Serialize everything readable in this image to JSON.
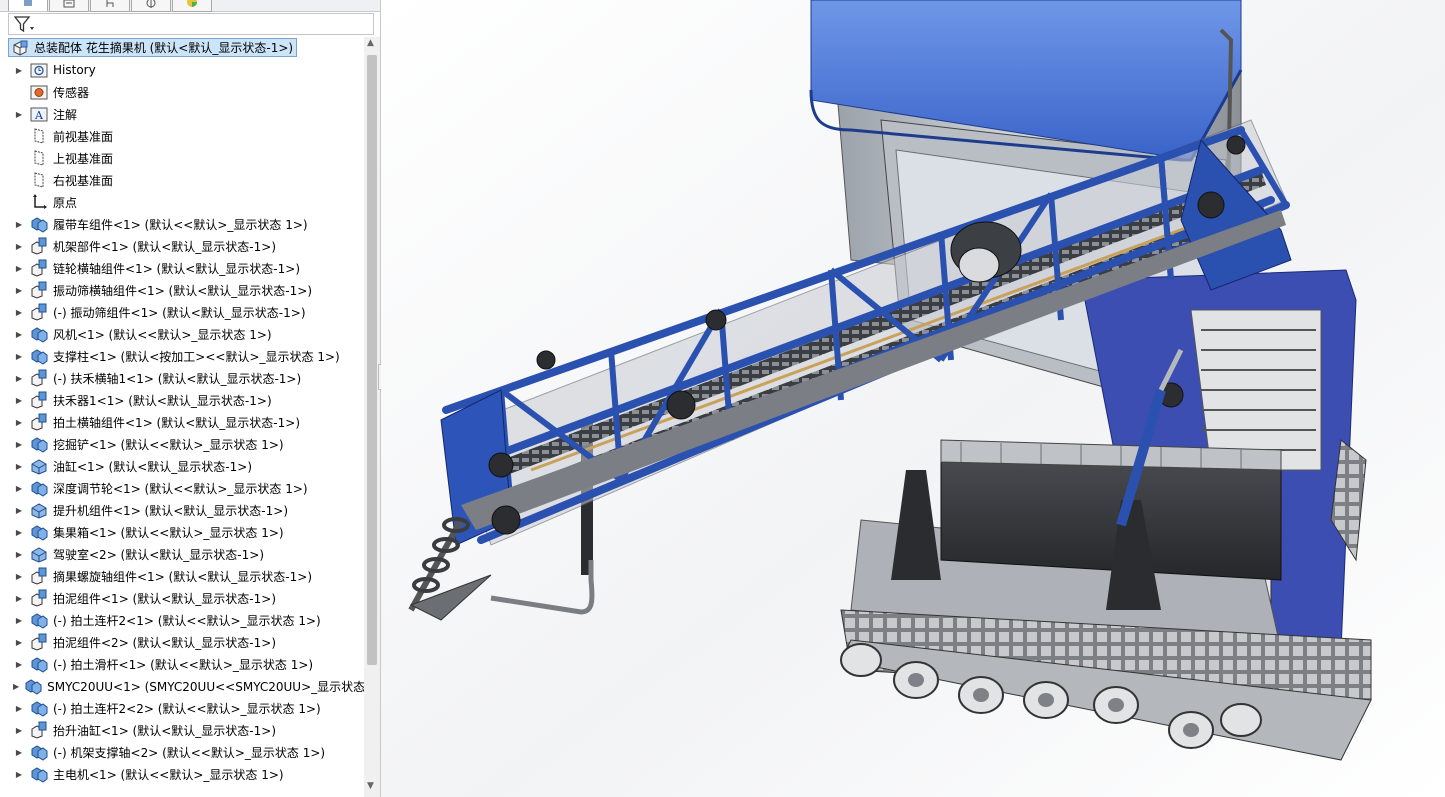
{
  "tree": {
    "root_label": "总装配体 花生摘果机 (默认<默认_显示状态-1>)",
    "items": [
      {
        "label": "History",
        "icon": "history-icon",
        "expand": true
      },
      {
        "label": "传感器",
        "icon": "sensor-icon",
        "expand": false
      },
      {
        "label": "注解",
        "icon": "annotation-icon",
        "expand": true
      },
      {
        "label": "前视基准面",
        "icon": "plane-icon",
        "expand": false
      },
      {
        "label": "上视基准面",
        "icon": "plane-icon",
        "expand": false
      },
      {
        "label": "右视基准面",
        "icon": "plane-icon",
        "expand": false
      },
      {
        "label": "原点",
        "icon": "origin-icon",
        "expand": false
      },
      {
        "label": "履带车组件<1> (默认<<默认>_显示状态 1>)",
        "icon": "subassembly-icon",
        "expand": true
      },
      {
        "label": "机架部件<1> (默认<默认_显示状态-1>)",
        "icon": "part-icon",
        "expand": true
      },
      {
        "label": "链轮横轴组件<1> (默认<默认_显示状态-1>)",
        "icon": "part-icon",
        "expand": true
      },
      {
        "label": "振动筛横轴组件<1> (默认<默认_显示状态-1>)",
        "icon": "part-icon",
        "expand": true
      },
      {
        "label": "(-) 振动筛组件<1> (默认<默认_显示状态-1>)",
        "icon": "part-icon",
        "expand": true
      },
      {
        "label": "风机<1> (默认<<默认>_显示状态 1>)",
        "icon": "subassembly-icon",
        "expand": true
      },
      {
        "label": "支撑柱<1> (默认<按加工><<默认>_显示状态 1>)",
        "icon": "subassembly-icon",
        "expand": true
      },
      {
        "label": "(-) 扶禾横轴1<1> (默认<默认_显示状态-1>)",
        "icon": "part-icon",
        "expand": true
      },
      {
        "label": "扶禾器1<1> (默认<默认_显示状态-1>)",
        "icon": "part-icon",
        "expand": true
      },
      {
        "label": "拍土横轴组件<1> (默认<默认_显示状态-1>)",
        "icon": "part-icon",
        "expand": true
      },
      {
        "label": "挖掘铲<1> (默认<<默认>_显示状态 1>)",
        "icon": "subassembly-icon",
        "expand": true
      },
      {
        "label": "油缸<1> (默认<默认_显示状态-1>)",
        "icon": "assembly-icon",
        "expand": true
      },
      {
        "label": "深度调节轮<1> (默认<<默认>_显示状态 1>)",
        "icon": "subassembly-icon",
        "expand": true
      },
      {
        "label": "提升机组件<1> (默认<默认_显示状态-1>)",
        "icon": "assembly-icon",
        "expand": true
      },
      {
        "label": "集果箱<1> (默认<<默认>_显示状态 1>)",
        "icon": "subassembly-icon",
        "expand": true
      },
      {
        "label": "驾驶室<2> (默认<默认_显示状态-1>)",
        "icon": "assembly-icon",
        "expand": true
      },
      {
        "label": "摘果螺旋轴组件<1> (默认<默认_显示状态-1>)",
        "icon": "part-icon",
        "expand": true
      },
      {
        "label": "拍泥组件<1> (默认<默认_显示状态-1>)",
        "icon": "part-icon",
        "expand": true
      },
      {
        "label": "(-) 拍土连杆2<1> (默认<<默认>_显示状态 1>)",
        "icon": "subassembly-icon",
        "expand": true
      },
      {
        "label": "拍泥组件<2> (默认<默认_显示状态-1>)",
        "icon": "part-icon",
        "expand": true
      },
      {
        "label": "(-) 拍土滑杆<1> (默认<<默认>_显示状态 1>)",
        "icon": "subassembly-icon",
        "expand": true
      },
      {
        "label": "SMYC20UU<1> (SMYC20UU<<SMYC20UU>_显示状态",
        "icon": "subassembly-icon",
        "expand": true
      },
      {
        "label": "(-) 拍土连杆2<2> (默认<<默认>_显示状态 1>)",
        "icon": "subassembly-icon",
        "expand": true
      },
      {
        "label": "抬升油缸<1> (默认<默认_显示状态-1>)",
        "icon": "part-icon",
        "expand": true
      },
      {
        "label": "(-) 机架支撑轴<2> (默认<<默认>_显示状态 1>)",
        "icon": "subassembly-icon",
        "expand": true
      },
      {
        "label": "主电机<1> (默认<<默认>_显示状态 1>)",
        "icon": "subassembly-icon",
        "expand": true
      }
    ]
  },
  "colors": {
    "accent": "#2f5bb7",
    "selection": "#cce4f7",
    "frame_blue": "#2a50b0"
  }
}
